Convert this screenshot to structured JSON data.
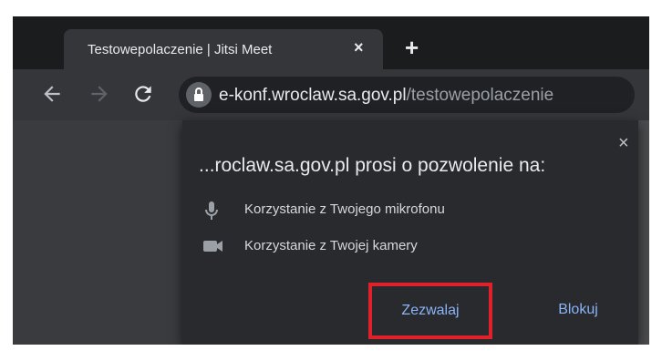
{
  "browser": {
    "tab": {
      "title": "Testowepolaczenie | Jitsi Meet",
      "close": "×",
      "new_tab": "+"
    },
    "address": {
      "host": "e-konf.wroclaw.sa.gov.pl",
      "path": "/testowepolaczenie"
    }
  },
  "permission_prompt": {
    "close": "×",
    "title": "...roclaw.sa.gov.pl prosi o pozwolenie na:",
    "items": [
      {
        "icon": "microphone-icon",
        "label": "Korzystanie z Twojego mikrofonu"
      },
      {
        "icon": "camera-icon",
        "label": "Korzystanie z Twojej kamery"
      }
    ],
    "allow_label": "Zezwalaj",
    "block_label": "Blokuj"
  },
  "colors": {
    "highlight": "#e0202a",
    "button_text": "#8ab4f8",
    "popup_bg": "#292a2d"
  }
}
